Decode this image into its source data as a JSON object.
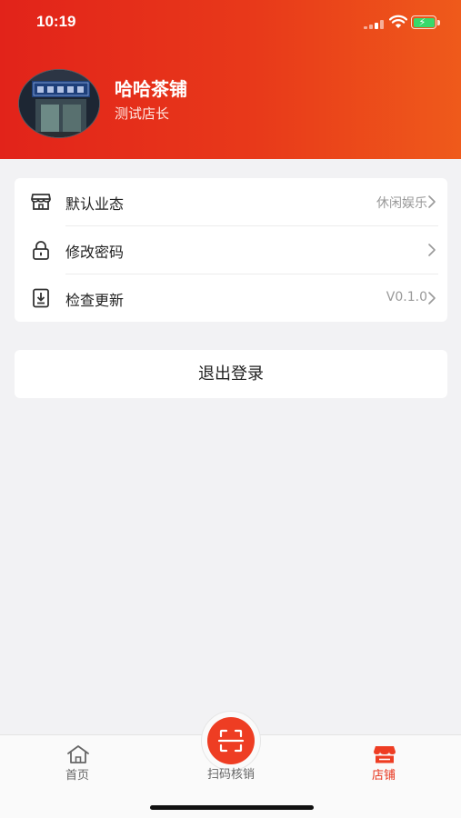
{
  "status_bar": {
    "time": "10:19"
  },
  "profile": {
    "shop_name": "哈哈茶铺",
    "role": "测试店长"
  },
  "menu": {
    "items": [
      {
        "label": "默认业态",
        "value": "休闲娱乐",
        "icon": "store-icon"
      },
      {
        "label": "修改密码",
        "value": "",
        "icon": "lock-icon"
      },
      {
        "label": "检查更新",
        "value": "V0.1.0",
        "icon": "download-icon"
      }
    ]
  },
  "logout": {
    "label": "退出登录"
  },
  "tabbar": {
    "home": {
      "label": "首页",
      "icon": "home-icon"
    },
    "scan": {
      "label": "扫码核销",
      "icon": "scan-icon"
    },
    "store": {
      "label": "店铺",
      "icon": "store-icon",
      "active": true
    }
  },
  "colors": {
    "header_start": "#e2231a",
    "header_end": "#ef5a1b",
    "accent": "#e8341c",
    "background": "#f2f2f4"
  }
}
